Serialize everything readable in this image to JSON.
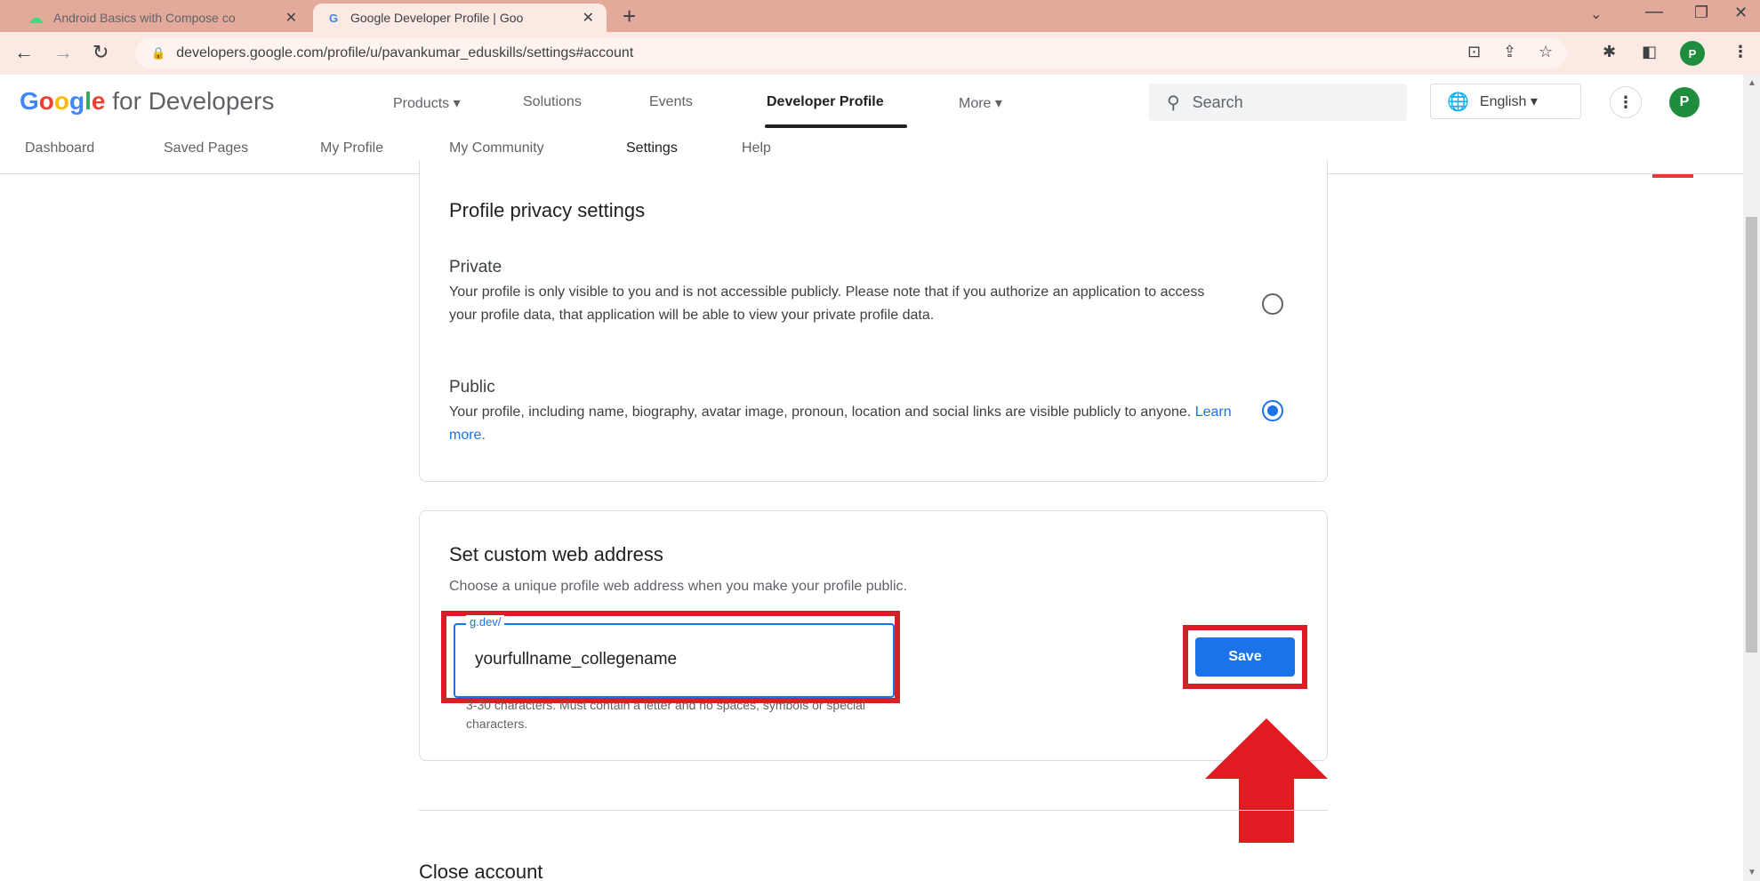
{
  "browser": {
    "tabs": [
      {
        "title": "Android Basics with Compose co",
        "active": false
      },
      {
        "title": "Google Developer Profile | Goo",
        "active": true
      }
    ],
    "url": "developers.google.com/profile/u/pavankumar_eduskills/settings#account",
    "profile_initial": "P"
  },
  "site": {
    "logo_google": [
      "G",
      "o",
      "o",
      "g",
      "l",
      "e"
    ],
    "logo_suffix": "for Developers",
    "nav": {
      "products": "Products ▾",
      "solutions": "Solutions",
      "events": "Events",
      "developer_profile": "Developer Profile",
      "more": "More ▾"
    },
    "search_placeholder": "Search",
    "language": "English ▾",
    "avatar_initial": "P",
    "subnav": {
      "dashboard": "Dashboard",
      "saved_pages": "Saved Pages",
      "my_profile": "My Profile",
      "my_community": "My Community",
      "settings": "Settings",
      "help": "Help"
    }
  },
  "privacy": {
    "title": "Profile privacy settings",
    "private": {
      "label": "Private",
      "description": "Your profile is only visible to you and is not accessible publicly. Please note that if you authorize an application to access your profile data, that application will be able to view your private profile data.",
      "selected": false
    },
    "public": {
      "label": "Public",
      "description": "Your profile, including name, biography, avatar image, pronoun, location and social links are visible publicly to anyone.",
      "link": "Learn more.",
      "selected": true
    }
  },
  "web_address": {
    "title": "Set custom web address",
    "subtitle": "Choose a unique profile web address when you make your profile public.",
    "field_label": "g.dev/",
    "field_value": "yourfullname_collegename",
    "hint": "3-30 characters. Must contain a letter and no spaces, symbols or special characters.",
    "save_label": "Save"
  },
  "close_account": {
    "title": "Close account"
  },
  "colors": {
    "accent": "#1a73e8",
    "highlight": "#d32029",
    "tabstrip": "#e3aa9c"
  }
}
